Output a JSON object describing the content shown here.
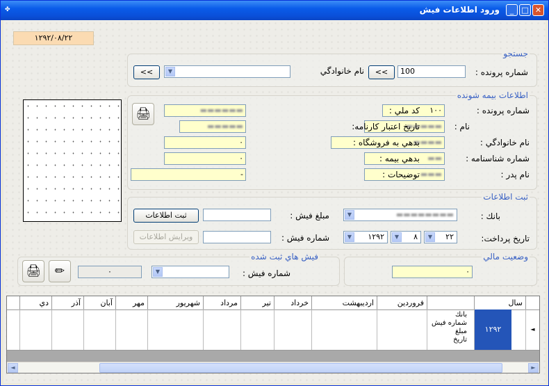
{
  "window": {
    "title": "ورود اطلاعات فيش"
  },
  "date": "١٢٩٢/٠٨/٢٢",
  "search": {
    "title": "جستجو",
    "file_label": "شماره پرونده :",
    "file_value": "100",
    "family_label": "نام خانوادگي",
    "btn": ">>"
  },
  "insured": {
    "title": "اطلاعات بيمه شونده",
    "file_no_label": "شماره پرونده :",
    "file_no_value": "١٠٠",
    "name_label": "نام :",
    "family_label": "نام خانوادگي :",
    "id_label": "شماره شناسنامه :",
    "father_label": "نام پدر :",
    "melli_label": "كد ملي :",
    "validity_label": "تاريخ اعتبار كارنامه:",
    "debt_store_label": "بدهي به فروشگاه :",
    "debt_store_value": "٠",
    "debt_ins_label": "بدهي بيمه :",
    "debt_ins_value": "٠",
    "desc_label": "توضيحات :",
    "desc_value": "-"
  },
  "register": {
    "title": "ثبت اطلاعات",
    "bank_label": "بانك :",
    "pay_date_label": "تاريخ پرداخت:",
    "day": "٢٢",
    "month": "٨",
    "year": "١٢٩٢",
    "amount_label": "مبلغ فيش :",
    "receipt_label": "شماره فيش :",
    "save_btn": "ثبت اطلاعات",
    "edit_btn": "ويرايش اطلاعات"
  },
  "financial": {
    "title": "وضعيت مالي",
    "value": "٠"
  },
  "receipts": {
    "title": "فيش هاي ثبت شده",
    "label": "شماره فيش :",
    "value": "٠"
  },
  "table": {
    "headers": [
      "سال",
      "",
      "فروردين",
      "ارديبهشت",
      "خرداد",
      "تير",
      "مرداد",
      "شهريور",
      "مهر",
      "آبان",
      "آذر",
      "دي"
    ],
    "row": {
      "year": "١٢٩٢",
      "labels": [
        "بانك",
        "شماره فيش",
        "مبلغ",
        "تاريخ"
      ],
      "pointer": "◄"
    }
  },
  "icons": {
    "printer": "printer-icon",
    "eraser": "eraser-icon",
    "minimize": "_",
    "maximize": "□",
    "close": "✕"
  }
}
